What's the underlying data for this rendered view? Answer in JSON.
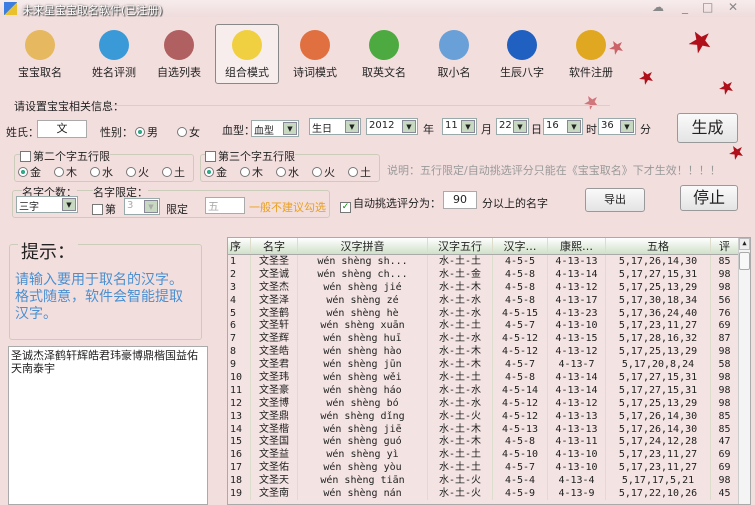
{
  "window": {
    "title": "未来星宝宝取名软件(已注册)"
  },
  "toolbar": [
    {
      "label": "宝宝取名",
      "icon": "baby-icon",
      "color": "#e6b860"
    },
    {
      "label": "姓名评测",
      "icon": "magnifier-icon",
      "color": "#3a9ad8"
    },
    {
      "label": "自选列表",
      "icon": "brushes-icon",
      "color": "#b06060"
    },
    {
      "label": "组合模式",
      "icon": "chick-icon",
      "color": "#f0d040"
    },
    {
      "label": "诗词模式",
      "icon": "blocks-icon",
      "color": "#e07040"
    },
    {
      "label": "取英文名",
      "icon": "mountain-icon",
      "color": "#4caa40"
    },
    {
      "label": "取小名",
      "icon": "crown-icon",
      "color": "#6aa0d8"
    },
    {
      "label": "生辰八字",
      "icon": "drop-icon",
      "color": "#2060c0"
    },
    {
      "label": "软件注册",
      "icon": "lock-icon",
      "color": "#e0a820"
    }
  ],
  "form": {
    "section_title": "请设置宝宝相关信息：",
    "surname_label": "姓氏：",
    "surname": "文",
    "gender_label": "性别：",
    "male": "男",
    "female": "女",
    "blood_label": "血型：",
    "blood": "血型",
    "birth": "生日",
    "year": "2012",
    "year_unit": "年",
    "month": "11",
    "month_unit": "月",
    "day": "22",
    "day_unit": "日",
    "hour": "16",
    "hour_unit": "时",
    "minute": "36",
    "minute_unit": "分",
    "second_char_limit": "第二个字五行限",
    "third_char_limit": "第三个字五行限",
    "elements": [
      "金",
      "木",
      "水",
      "火",
      "土"
    ],
    "note": "说明：五行限定/自动挑选评分只能在《宝宝取名》下才生效！！！！",
    "count_label": "名字个数：",
    "count": "三字",
    "limit_label": "名字限定：",
    "limit_nth": "第",
    "limit_pos": "3",
    "limit_word": "限定",
    "limit_char": "五",
    "limit_warn": "一般不建议勾选",
    "auto_label": "自动挑选评分为：",
    "auto_score": "90",
    "auto_suffix": "分以上的名字",
    "generate": "生成",
    "export": "导出",
    "stop": "停止"
  },
  "hint": {
    "title": "提示：",
    "text": "请输入要用于取名的汉字。格式随意，软件会智能提取汉字。",
    "input": "圣诚杰泽鹤轩辉皓君玮豪博鼎楷国益佑天南泰宇"
  },
  "table": {
    "headers": [
      "序",
      "名字",
      "汉字拼音",
      "汉字五行",
      "汉字…",
      "康熙…",
      "五格",
      "评"
    ],
    "rows": [
      [
        "1",
        "文圣圣",
        "wén shèng sh...",
        "水-土-土",
        "4-5-5",
        "4-13-13",
        "5,17,26,14,30",
        "85"
      ],
      [
        "2",
        "文圣诚",
        "wén shèng ch...",
        "水-土-金",
        "4-5-8",
        "4-13-14",
        "5,17,27,15,31",
        "98"
      ],
      [
        "3",
        "文圣杰",
        "wén shèng jié",
        "水-土-木",
        "4-5-8",
        "4-13-12",
        "5,17,25,13,29",
        "98"
      ],
      [
        "4",
        "文圣泽",
        "wén shèng zé",
        "水-土-水",
        "4-5-8",
        "4-13-17",
        "5,17,30,18,34",
        "56"
      ],
      [
        "5",
        "文圣鹤",
        "wén shèng hè",
        "水-土-水",
        "4-5-15",
        "4-13-23",
        "5,17,36,24,40",
        "76"
      ],
      [
        "6",
        "文圣轩",
        "wén shèng xuān",
        "水-土-土",
        "4-5-7",
        "4-13-10",
        "5,17,23,11,27",
        "69"
      ],
      [
        "7",
        "文圣辉",
        "wén shèng huī",
        "水-土-水",
        "4-5-12",
        "4-13-15",
        "5,17,28,16,32",
        "87"
      ],
      [
        "8",
        "文圣皓",
        "wén shèng hào",
        "水-土-木",
        "4-5-12",
        "4-13-12",
        "5,17,25,13,29",
        "98"
      ],
      [
        "9",
        "文圣君",
        "wén shèng jūn",
        "水-土-木",
        "4-5-7",
        "4-13-7",
        "5,17,20,8,24",
        "58"
      ],
      [
        "10",
        "文圣玮",
        "wén shèng wěi",
        "水-土-土",
        "4-5-8",
        "4-13-14",
        "5,17,27,15,31",
        "98"
      ],
      [
        "11",
        "文圣豪",
        "wén shèng háo",
        "水-土-水",
        "4-5-14",
        "4-13-14",
        "5,17,27,15,31",
        "98"
      ],
      [
        "12",
        "文圣博",
        "wén shèng bó",
        "水-土-水",
        "4-5-12",
        "4-13-12",
        "5,17,25,13,29",
        "98"
      ],
      [
        "13",
        "文圣鼎",
        "wén shèng dǐng",
        "水-土-火",
        "4-5-12",
        "4-13-13",
        "5,17,26,14,30",
        "85"
      ],
      [
        "14",
        "文圣楷",
        "wén shèng jiē",
        "水-土-木",
        "4-5-13",
        "4-13-13",
        "5,17,26,14,30",
        "85"
      ],
      [
        "15",
        "文圣国",
        "wén shèng guó",
        "水-土-木",
        "4-5-8",
        "4-13-11",
        "5,17,24,12,28",
        "47"
      ],
      [
        "16",
        "文圣益",
        "wén shèng yì",
        "水-土-土",
        "4-5-10",
        "4-13-10",
        "5,17,23,11,27",
        "69"
      ],
      [
        "17",
        "文圣佑",
        "wén shèng yòu",
        "水-土-土",
        "4-5-7",
        "4-13-10",
        "5,17,23,11,27",
        "69"
      ],
      [
        "18",
        "文圣天",
        "wén shèng tiān",
        "水-土-火",
        "4-5-4",
        "4-13-4",
        "5,17,17,5,21",
        "98"
      ],
      [
        "19",
        "文圣南",
        "wén shèng nán",
        "水-土-火",
        "4-5-9",
        "4-13-9",
        "5,17,22,10,26",
        "45"
      ]
    ]
  }
}
